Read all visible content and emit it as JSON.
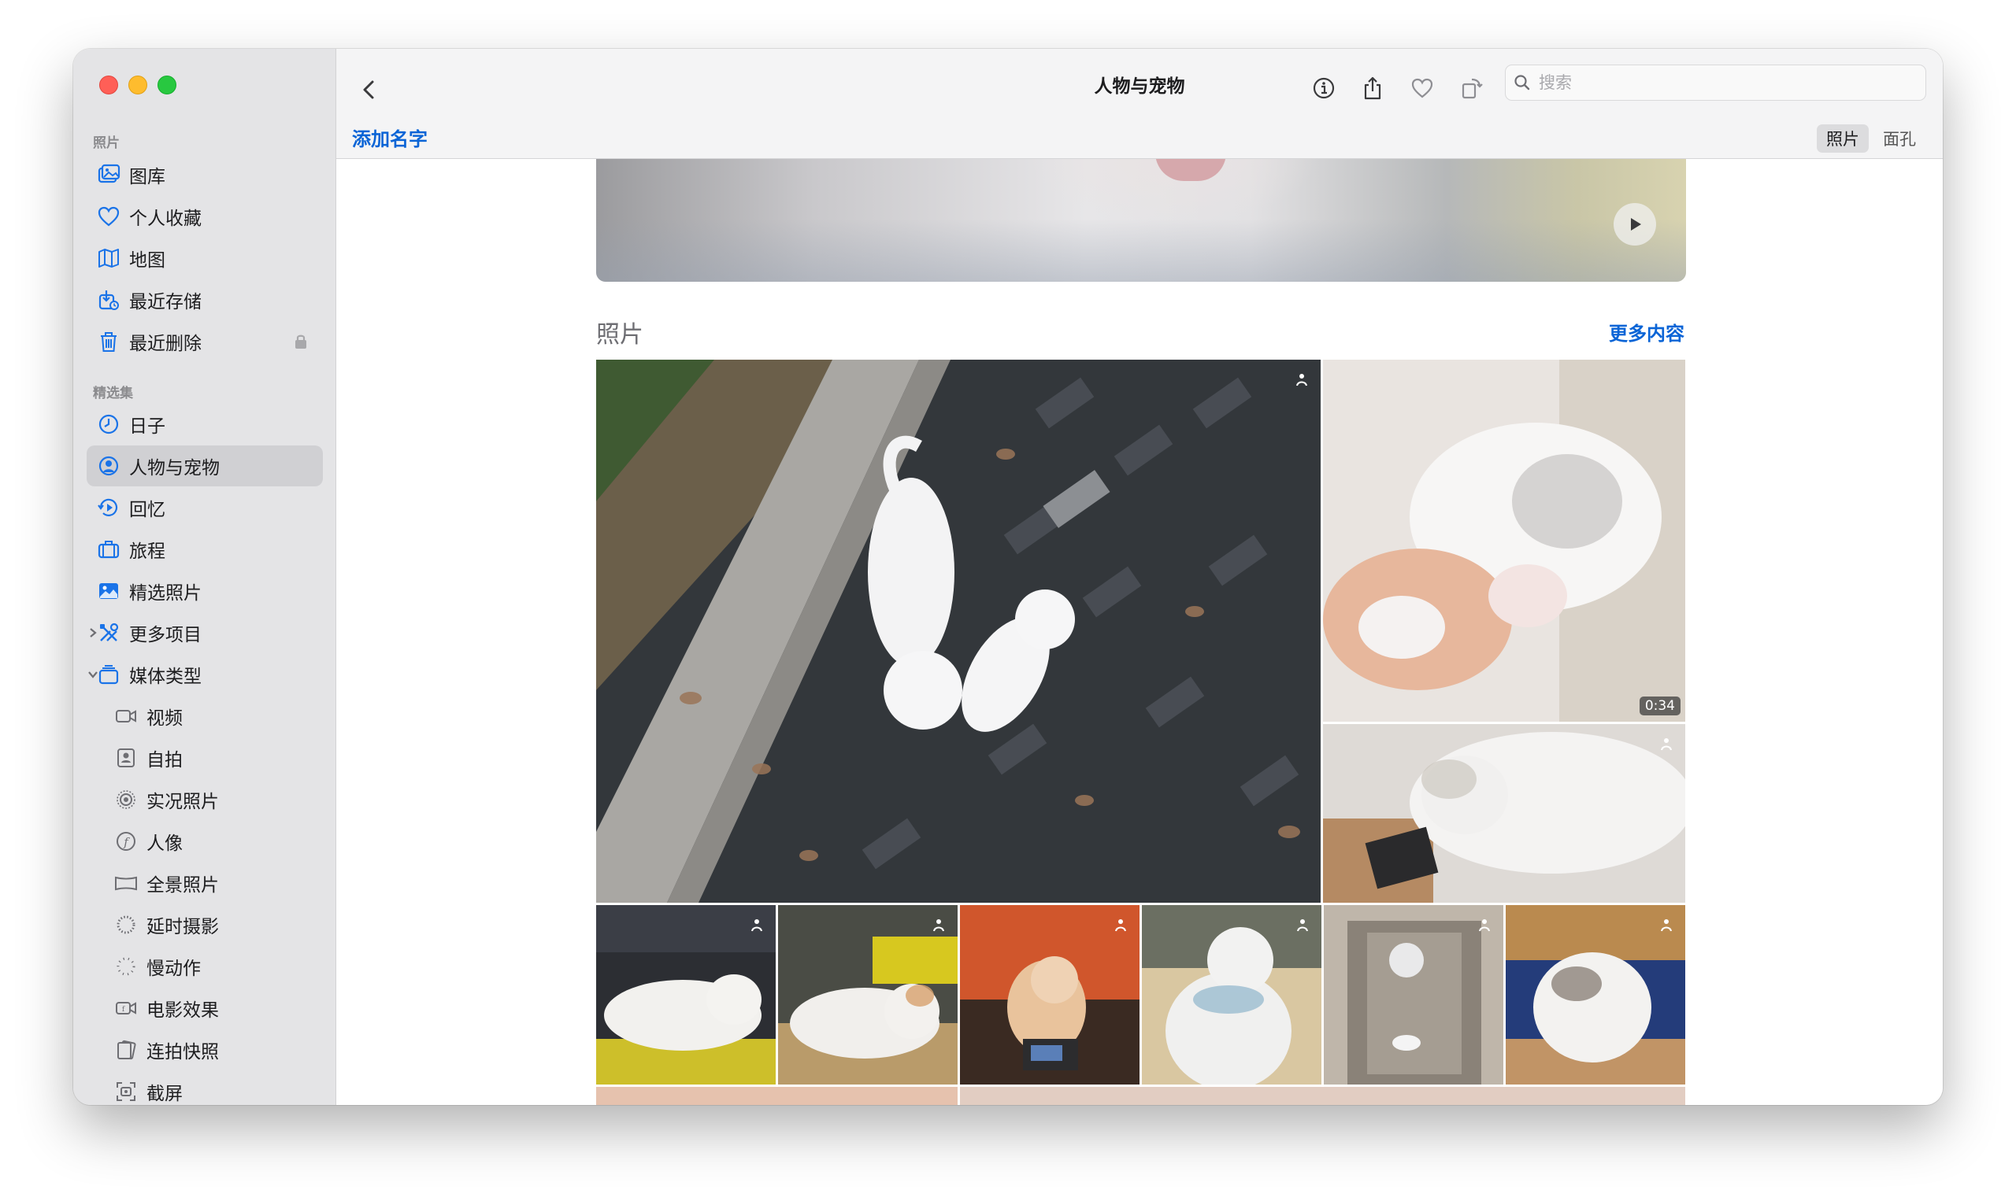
{
  "window": {
    "title": "人物与宠物"
  },
  "sidebar": {
    "sections": [
      {
        "header": "照片",
        "items": [
          {
            "label": "图库",
            "icon": "photo-library-icon"
          },
          {
            "label": "个人收藏",
            "icon": "heart-icon"
          },
          {
            "label": "地图",
            "icon": "map-icon"
          },
          {
            "label": "最近存储",
            "icon": "recently-saved-icon"
          },
          {
            "label": "最近删除",
            "icon": "trash-icon",
            "locked": true
          }
        ]
      },
      {
        "header": "精选集",
        "items": [
          {
            "label": "日子",
            "icon": "clock-icon"
          },
          {
            "label": "人物与宠物",
            "icon": "person-circle-icon",
            "selected": true
          },
          {
            "label": "回忆",
            "icon": "memories-icon"
          },
          {
            "label": "旅程",
            "icon": "suitcase-icon"
          },
          {
            "label": "精选照片",
            "icon": "featured-photo-icon"
          },
          {
            "label": "更多项目",
            "icon": "tools-icon",
            "expandable": true,
            "expanded": false
          },
          {
            "label": "媒体类型",
            "icon": "stack-icon",
            "expandable": true,
            "expanded": true
          }
        ]
      }
    ],
    "media_types": [
      {
        "label": "视频",
        "icon": "video-icon"
      },
      {
        "label": "自拍",
        "icon": "selfie-icon"
      },
      {
        "label": "实况照片",
        "icon": "live-photo-icon"
      },
      {
        "label": "人像",
        "icon": "portrait-icon"
      },
      {
        "label": "全景照片",
        "icon": "panorama-icon"
      },
      {
        "label": "延时摄影",
        "icon": "timelapse-icon"
      },
      {
        "label": "慢动作",
        "icon": "slowmo-icon"
      },
      {
        "label": "电影效果",
        "icon": "cinematic-icon"
      },
      {
        "label": "连拍快照",
        "icon": "burst-icon"
      },
      {
        "label": "截屏",
        "icon": "screenshot-icon"
      }
    ]
  },
  "toolbar": {
    "search_placeholder": "搜索",
    "add_name_label": "添加名字",
    "segments": [
      "照片",
      "面孔"
    ],
    "selected_segment": "照片"
  },
  "content": {
    "section_title": "照片",
    "more_label": "更多内容",
    "video_duration": "0:34"
  },
  "colors": {
    "accent": "#0a64d6",
    "sidebar_bg": "#e4e4e6",
    "selection": "#d0d0d3"
  }
}
